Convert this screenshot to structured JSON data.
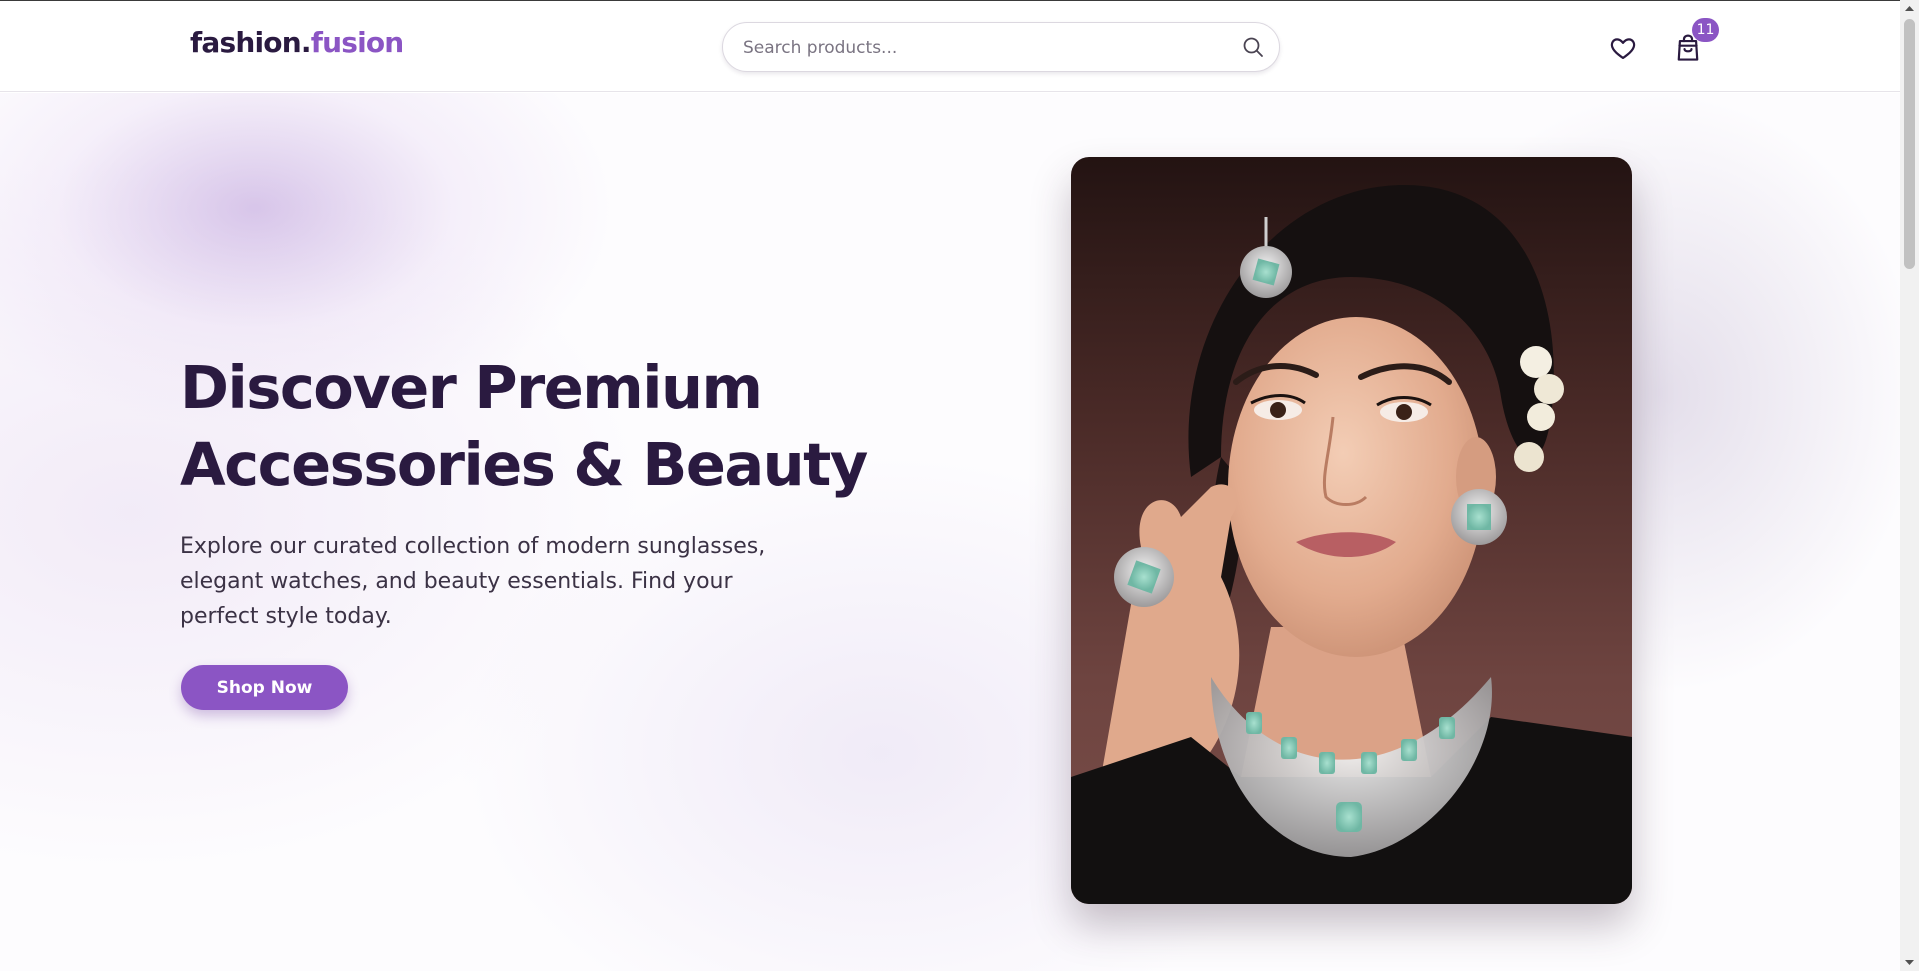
{
  "header": {
    "logo_main": "fashion.",
    "logo_accent": "fusion",
    "search_placeholder": "Search products...",
    "cart_count": "11",
    "icons": [
      "search-icon",
      "heart-icon",
      "shopping-bag-icon"
    ]
  },
  "hero": {
    "headline_line1": "Discover Premium",
    "headline_line2": "Accessories & Beauty",
    "subtext": "Explore our curated collection of modern sunglasses, elegant watches, and beauty essentials. Find your perfect style today.",
    "cta_label": "Shop Now",
    "image_alt": "Woman wearing mint and silver bridal jewelry"
  },
  "colors": {
    "accent": "#8b55c4",
    "heading": "#2a1a40",
    "body_text": "#3b3245"
  }
}
